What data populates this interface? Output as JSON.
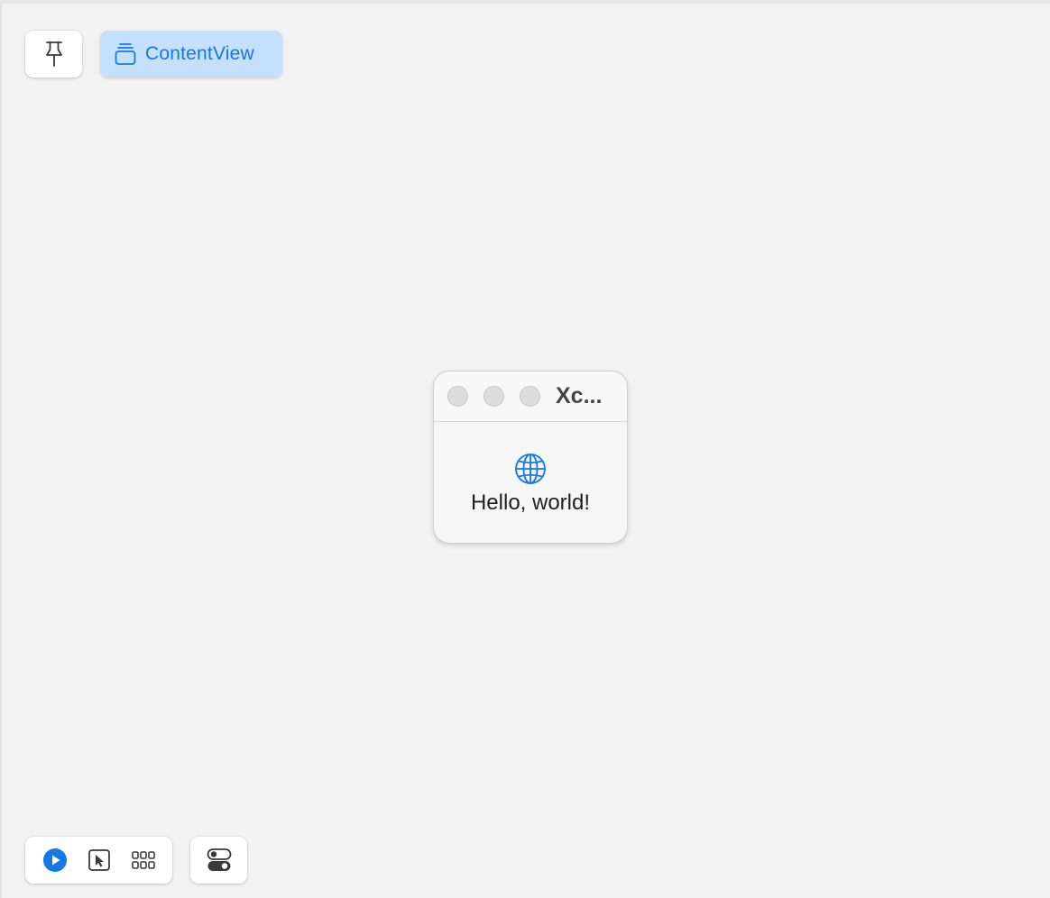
{
  "toolbar": {
    "pin_icon": "pin-icon",
    "chip": {
      "label": "ContentView",
      "icon": "stacked-rectangles-icon",
      "background": "#c5e0fb",
      "color": "#1478e6"
    }
  },
  "preview_window": {
    "title": "Xc...",
    "traffic_lights": [
      "close",
      "minimize",
      "zoom"
    ],
    "body": {
      "icon": "globe-icon",
      "icon_color": "#1478e6",
      "text": "Hello, world!"
    }
  },
  "bottom_controls": {
    "live_mode_icon": "play-circle-icon",
    "selectable_mode_icon": "cursor-select-icon",
    "grid_icon": "variants-grid-icon",
    "settings_icon": "toggle-switches-icon",
    "accent": "#1478e6"
  }
}
